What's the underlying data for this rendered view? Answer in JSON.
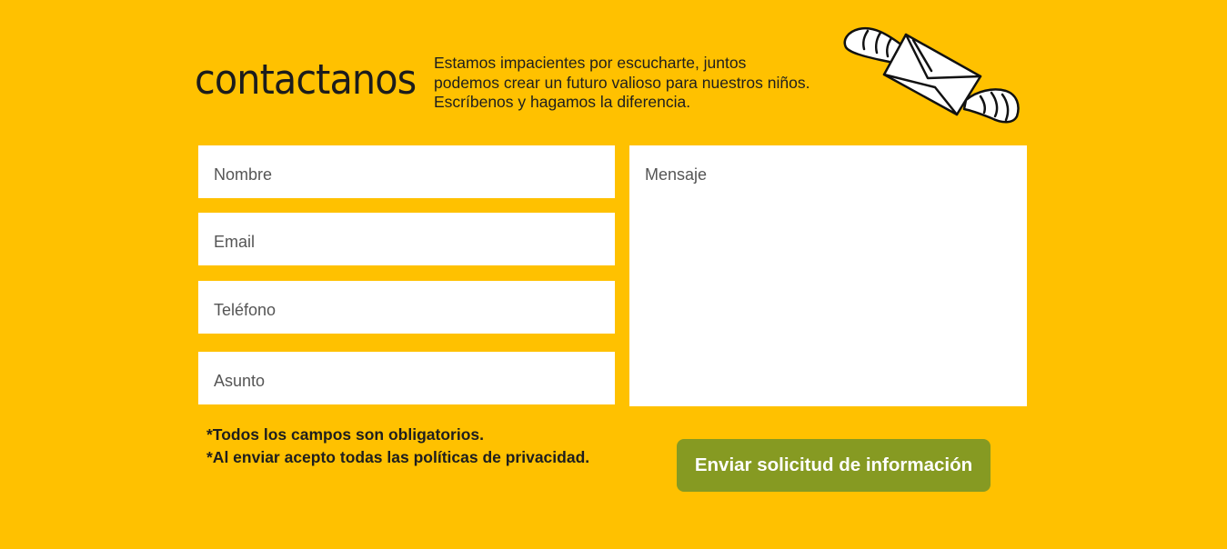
{
  "header": {
    "title": "contactanos",
    "intro": "Estamos impacientes por escucharte,  juntos\npodemos crear un futuro valioso para nuestros niños.\nEscríbenos y hagamos la diferencia."
  },
  "form": {
    "name_placeholder": "Nombre",
    "email_placeholder": "Email",
    "phone_placeholder": "Teléfono",
    "subject_placeholder": "Asunto",
    "message_placeholder": "Mensaje",
    "note_required": "*Todos los campos son obligatorios.",
    "note_privacy": "*Al enviar acepto todas las políticas de privacidad.",
    "submit_label": "Enviar solicitud de información"
  },
  "icons": {
    "decoration": "winged-envelope-icon"
  },
  "colors": {
    "background": "#FFC100",
    "button": "#869A22",
    "field": "#FFFFFF",
    "text": "#1E1E1E"
  }
}
